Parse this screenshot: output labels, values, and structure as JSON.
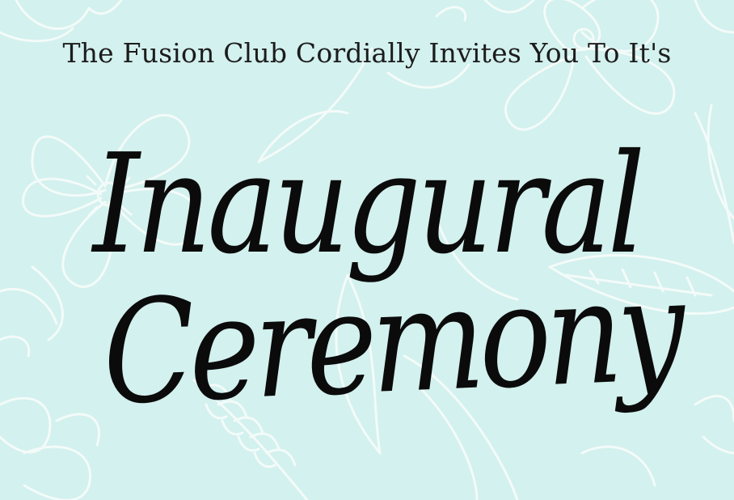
{
  "invitation": {
    "line": "The Fusion Club Cordially Invites You To It's",
    "title_line_1": "Inaugural",
    "title_line_2": "Ceremony"
  },
  "colors": {
    "background": "#d3f1ee",
    "botanical_lines": "#f4fbf9",
    "text": "#1c1c1c"
  }
}
